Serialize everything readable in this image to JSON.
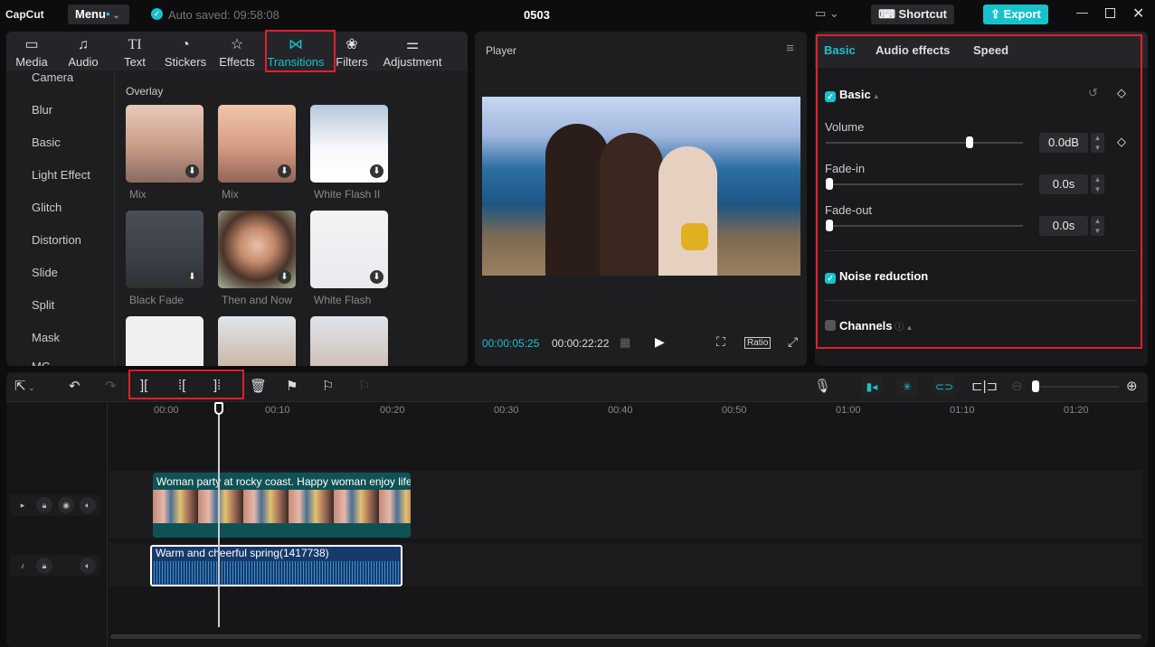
{
  "app": {
    "logo": "CapCut",
    "menu": "Menu",
    "autosave": "Auto saved: 09:58:08",
    "project_title": "0503",
    "shortcut": "Shortcut",
    "export": "Export"
  },
  "media_tabs": [
    {
      "label": "Media",
      "icon": "▭"
    },
    {
      "label": "Audio",
      "icon": "♫"
    },
    {
      "label": "Text",
      "icon": "TI"
    },
    {
      "label": "Stickers",
      "icon": "◔"
    },
    {
      "label": "Effects",
      "icon": "☆"
    },
    {
      "label": "Transitions",
      "icon": "⋈",
      "active": true
    },
    {
      "label": "Filters",
      "icon": "❀"
    },
    {
      "label": "Adjustment",
      "icon": "⚌"
    }
  ],
  "categories": [
    "Camera",
    "Blur",
    "Basic",
    "Light Effect",
    "Glitch",
    "Distortion",
    "Slide",
    "Split",
    "Mask",
    "MG"
  ],
  "section": "Overlay",
  "transitions": [
    {
      "label": "Mix"
    },
    {
      "label": "Mix"
    },
    {
      "label": "White Flash II"
    },
    {
      "label": "Black Fade"
    },
    {
      "label": "Then and Now"
    },
    {
      "label": "White Flash"
    },
    {
      "label": ""
    },
    {
      "label": ""
    },
    {
      "label": ""
    }
  ],
  "player": {
    "title": "Player",
    "current_time": "00:00:05:25",
    "total_time": "00:00:22:22",
    "ratio": "Ratio"
  },
  "inspector": {
    "tabs": [
      "Basic",
      "Audio effects",
      "Speed"
    ],
    "active_tab": "Basic",
    "basic_section": "Basic",
    "basic_checked": true,
    "volume": {
      "label": "Volume",
      "value": "0.0dB",
      "level": 0.74
    },
    "fade_in": {
      "label": "Fade-in",
      "value": "0.0s",
      "level": 0
    },
    "fade_out": {
      "label": "Fade-out",
      "value": "0.0s",
      "level": 0
    },
    "noise_reduction": {
      "label": "Noise reduction",
      "checked": true
    },
    "channels": {
      "label": "Channels",
      "checked": false
    }
  },
  "timeline": {
    "ticks": [
      "00:00",
      "00:10",
      "00:20",
      "00:30",
      "00:40",
      "00:50",
      "01:00",
      "01:10",
      "01:20"
    ],
    "video_clip": "Woman party at rocky coast. Happy woman enjoy life",
    "audio_clip": "Warm and cheerful spring(1417738)"
  },
  "colors": {
    "accent": "#18c2cc",
    "highlight": "#e0202a",
    "video_clip": "#0f5255",
    "audio_clip": "#173a6a"
  }
}
